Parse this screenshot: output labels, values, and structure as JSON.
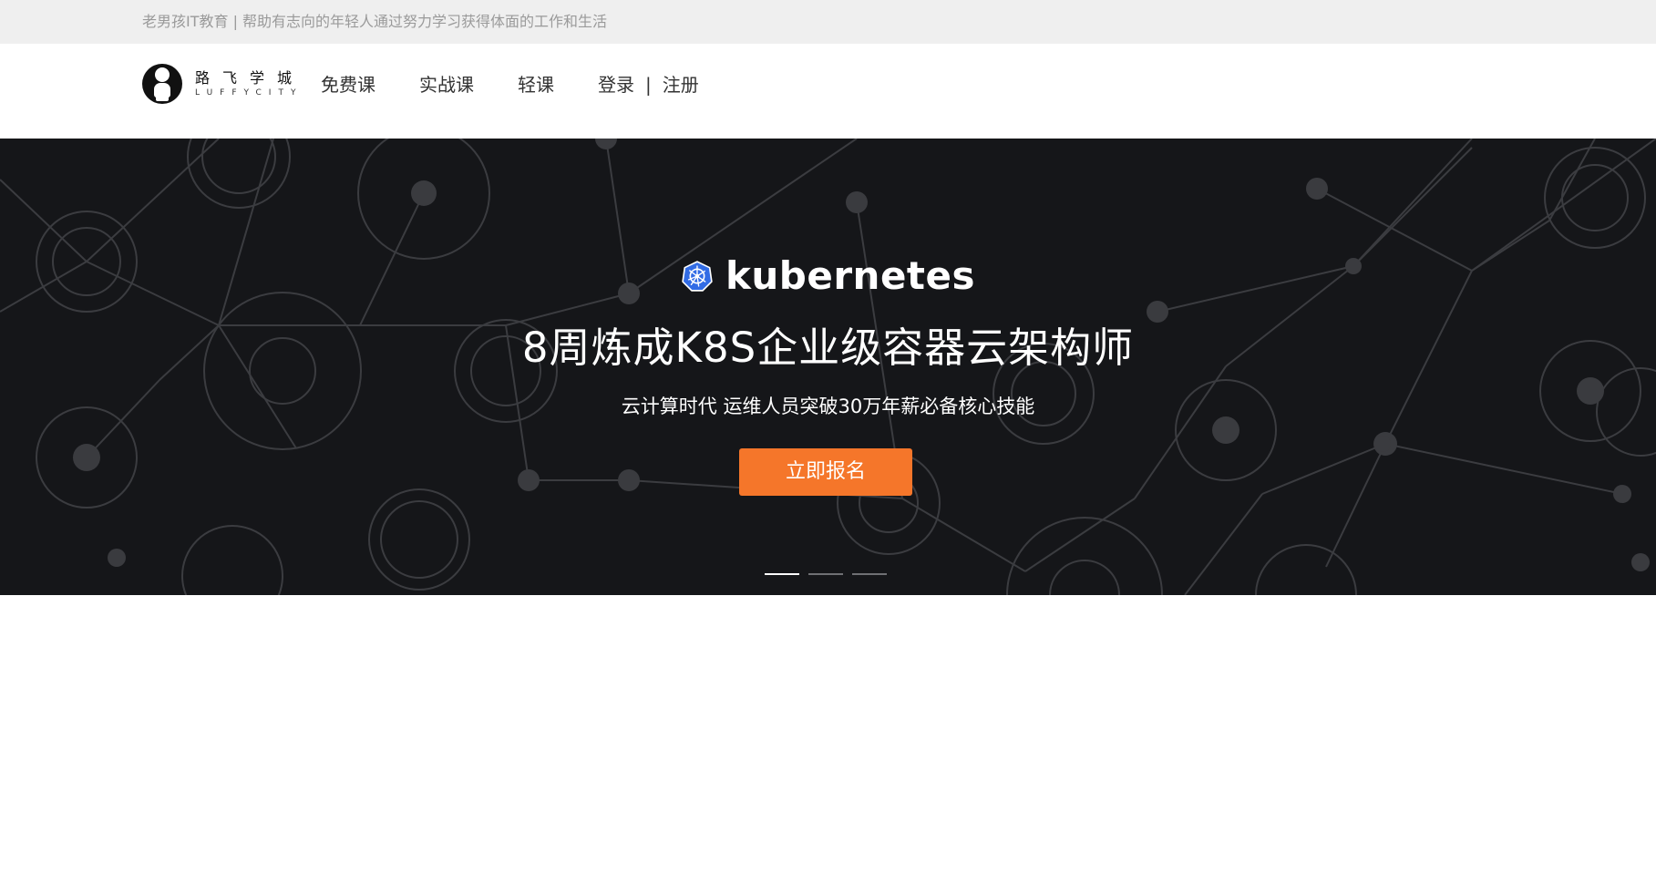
{
  "topbar": {
    "text": "老男孩IT教育 | 帮助有志向的年轻人通过努力学习获得体面的工作和生活"
  },
  "logo": {
    "cn": "路飞学城",
    "en": "LUFFYCITY"
  },
  "nav": {
    "items": [
      {
        "label": "免费课"
      },
      {
        "label": "实战课"
      },
      {
        "label": "轻课"
      }
    ],
    "login": "登录",
    "separator": "|",
    "register": "注册"
  },
  "banner": {
    "brand": "kubernetes",
    "title": "8周炼成K8S企业级容器云架构师",
    "subtitle": "云计算时代 运维人员突破30万年薪必备核心技能",
    "cta": "立即报名",
    "slides": 3,
    "active_slide": 1
  },
  "colors": {
    "topbar_bg": "#efefef",
    "topbar_text": "#9a9a9a",
    "banner_bg": "#151619",
    "accent": "#f5762a",
    "k8s_blue": "#326ce5"
  }
}
